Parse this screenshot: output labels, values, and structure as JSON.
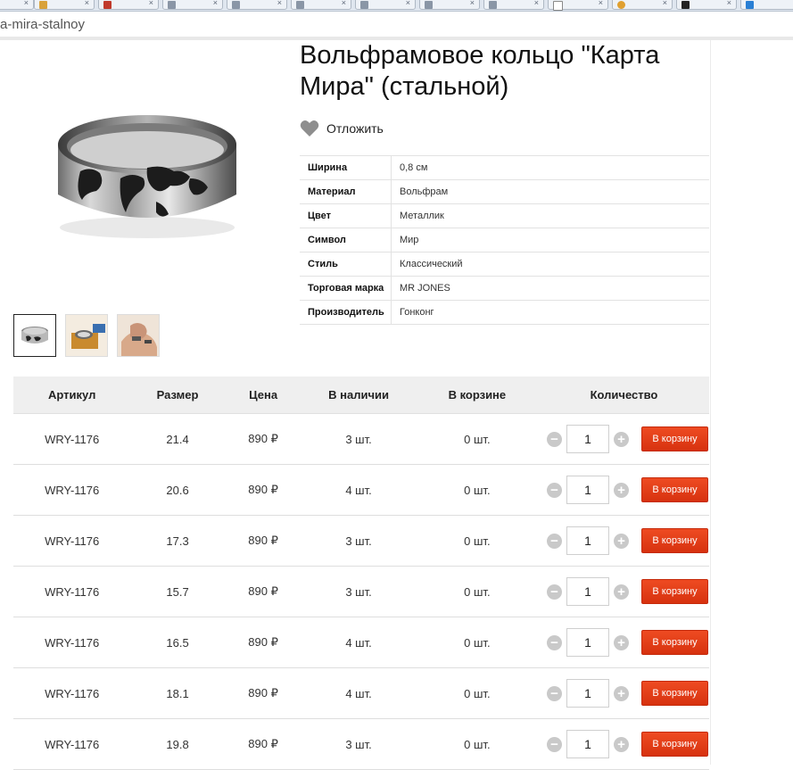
{
  "browser": {
    "url_fragment": "a-mira-stalnoy"
  },
  "product": {
    "title": "Вольфрамовое кольцо \"Карта Мира\" (стальной)",
    "favorite_label": "Отложить",
    "image_icon": "ring-icon",
    "thumbnails": [
      "ring-thumb",
      "ring-box-thumb",
      "ring-hand-thumb"
    ]
  },
  "properties": [
    {
      "name": "Ширина",
      "value": "0,8 см"
    },
    {
      "name": "Материал",
      "value": "Вольфрам"
    },
    {
      "name": "Цвет",
      "value": "Металлик"
    },
    {
      "name": "Символ",
      "value": "Мир"
    },
    {
      "name": "Стиль",
      "value": "Классический"
    },
    {
      "name": "Торговая марка",
      "value": "MR JONES"
    },
    {
      "name": "Производитель",
      "value": "Гонконг"
    }
  ],
  "offers": {
    "headers": {
      "article": "Артикул",
      "size": "Размер",
      "price": "Цена",
      "stock": "В наличии",
      "in_cart": "В корзине",
      "quantity": "Количество"
    },
    "cart_button_label": "В корзину",
    "rows": [
      {
        "article": "WRY-1176",
        "size": "21.4",
        "price": "890 ₽",
        "stock": "3 шт.",
        "in_cart": "0 шт.",
        "qty": "1"
      },
      {
        "article": "WRY-1176",
        "size": "20.6",
        "price": "890 ₽",
        "stock": "4 шт.",
        "in_cart": "0 шт.",
        "qty": "1"
      },
      {
        "article": "WRY-1176",
        "size": "17.3",
        "price": "890 ₽",
        "stock": "3 шт.",
        "in_cart": "0 шт.",
        "qty": "1"
      },
      {
        "article": "WRY-1176",
        "size": "15.7",
        "price": "890 ₽",
        "stock": "3 шт.",
        "in_cart": "0 шт.",
        "qty": "1"
      },
      {
        "article": "WRY-1176",
        "size": "16.5",
        "price": "890 ₽",
        "stock": "4 шт.",
        "in_cart": "0 шт.",
        "qty": "1"
      },
      {
        "article": "WRY-1176",
        "size": "18.1",
        "price": "890 ₽",
        "stock": "4 шт.",
        "in_cart": "0 шт.",
        "qty": "1"
      },
      {
        "article": "WRY-1176",
        "size": "19.8",
        "price": "890 ₽",
        "stock": "3 шт.",
        "in_cart": "0 шт.",
        "qty": "1"
      }
    ]
  },
  "colors": {
    "cart_button": "#e13a1a",
    "header_bg": "#efefef",
    "heart": "#8e8e8e"
  }
}
